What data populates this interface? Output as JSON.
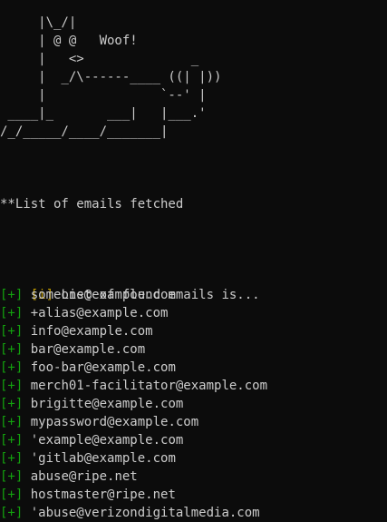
{
  "ascii_art": "     |\\_/|\n     | @ @   Woof!\n     |   <>              _\n     |  _/\\------____ ((| |))\n     |               `--' |\n ____|_       ___|   |___.'\n/_/_____/____/_______|",
  "heading": "**List of emails fetched",
  "info_prefix": "[i]",
  "info_message": " List of found emails is...",
  "item_prefix": "[+]",
  "emails": [
    "someone@example.com",
    "+alias@example.com",
    "info@example.com",
    "bar@example.com",
    "foo-bar@example.com",
    "merch01-facilitator@example.com",
    "brigitte@example.com",
    "mypassword@example.com",
    "'example@example.com",
    "'gitlab@example.com",
    "abuse@ripe.net",
    "hostmaster@ripe.net",
    "'abuse@verizondigitalmedia.com"
  ],
  "colors": {
    "background": "#0c0c0c",
    "text": "#cccccc",
    "info_prefix": "#c19c00",
    "plus_prefix": "#13a10e"
  }
}
